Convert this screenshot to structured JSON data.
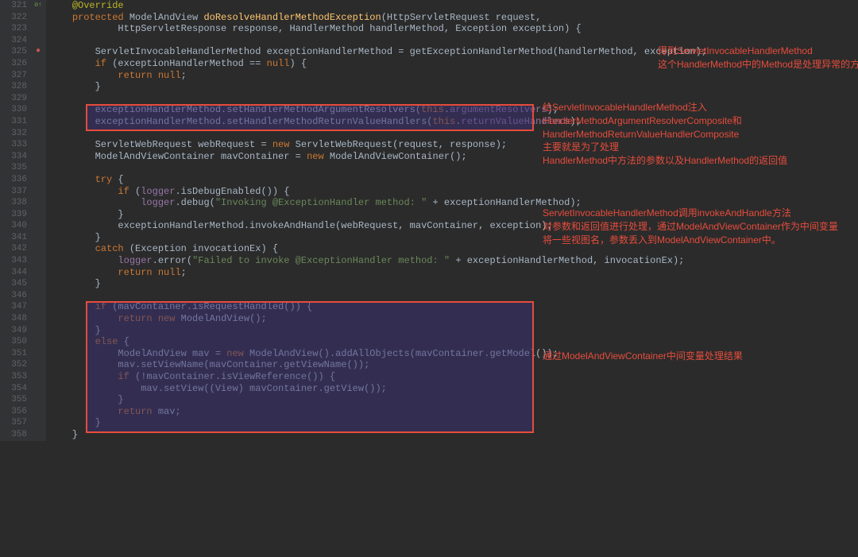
{
  "lines": {
    "start": 321,
    "end": 358
  },
  "code": {
    "l321_anno": "@Override",
    "l322": "protected ModelAndView doResolveHandlerMethodException(HttpServletRequest request,",
    "l323": "        HttpServletResponse response, HandlerMethod handlerMethod, Exception exception) {",
    "l324": "",
    "l325": "    ServletInvocableHandlerMethod exceptionHandlerMethod = getExceptionHandlerMethod(handlerMethod, exception);",
    "l326": "    if (exceptionHandlerMethod == null) {",
    "l327": "        return null;",
    "l328": "    }",
    "l329": "",
    "l330": "    exceptionHandlerMethod.setHandlerMethodArgumentResolvers(this.argumentResolvers);",
    "l331": "    exceptionHandlerMethod.setHandlerMethodReturnValueHandlers(this.returnValueHandlers);",
    "l332": "",
    "l333": "    ServletWebRequest webRequest = new ServletWebRequest(request, response);",
    "l334": "    ModelAndViewContainer mavContainer = new ModelAndViewContainer();",
    "l335": "",
    "l336": "    try {",
    "l337": "        if (logger.isDebugEnabled()) {",
    "l338": "            logger.debug(\"Invoking @ExceptionHandler method: \" + exceptionHandlerMethod);",
    "l339": "        }",
    "l340": "        exceptionHandlerMethod.invokeAndHandle(webRequest, mavContainer, exception);",
    "l341": "    }",
    "l342": "    catch (Exception invocationEx) {",
    "l343": "        logger.error(\"Failed to invoke @ExceptionHandler method: \" + exceptionHandlerMethod, invocationEx);",
    "l344": "        return null;",
    "l345": "    }",
    "l346": "",
    "l347": "    if (mavContainer.isRequestHandled()) {",
    "l348": "        return new ModelAndView();",
    "l349": "    }",
    "l350": "    else {",
    "l351": "        ModelAndView mav = new ModelAndView().addAllObjects(mavContainer.getModel());",
    "l352": "        mav.setViewName(mavContainer.getViewName());",
    "l353": "        if (!mavContainer.isViewReference()) {",
    "l354": "            mav.setView((View) mavContainer.getView());",
    "l355": "        }",
    "l356": "        return mav;",
    "l357": "    }",
    "l358": "}"
  },
  "annotations": {
    "a1_line1": "得到ServletInvocableHandlerMethod",
    "a1_line2": "这个HandlerMethod中的Method是处理异常的方法",
    "a2_line1": "给ServletInvocableHandlerMethod注入",
    "a2_line2": "HandlerMethodArgumentResolverComposite和",
    "a2_line3": "HandlerMethodReturnValueHandlerComposite",
    "a2_line4": "主要就是为了处理",
    "a2_line5": "HandlerMethod中方法的参数以及HandlerMethod的返回值",
    "a3_line1": "ServletInvocableHandlerMethod调用invokeAndHandle方法",
    "a3_line2": "对参数和返回值进行处理，通过ModelAndViewContainer作为中间变量",
    "a3_line3": "将一些视图名，参数丢入到ModelAndViewContainer中。",
    "a4": "通过ModelAndViewContainer中间变量处理结果"
  }
}
